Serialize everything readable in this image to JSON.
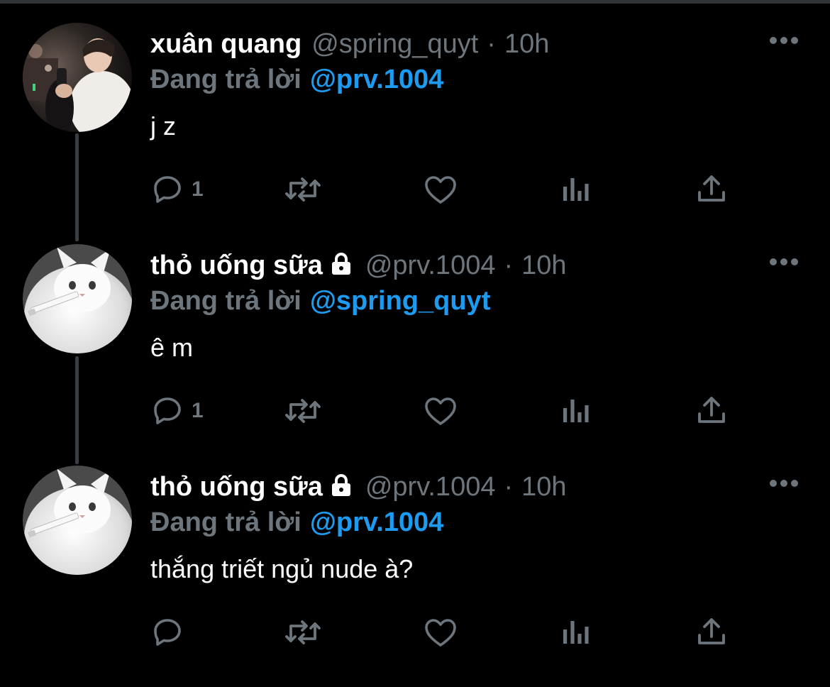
{
  "colors": {
    "background": "#000000",
    "text_primary": "#ffffff",
    "text_secondary": "#6e767d",
    "accent": "#1d9bf0",
    "thread_line": "#3a3d41"
  },
  "tweets": [
    {
      "name": "xuân quang",
      "locked": false,
      "handle": "@spring_quyt",
      "separator": "·",
      "time": "10h",
      "reply_prefix": "Đang trả lời",
      "reply_to": "@prv.1004",
      "text": "j z",
      "reply_count": "1",
      "avatar": "person-photo-avatar"
    },
    {
      "name": "thỏ uống sữa",
      "locked": true,
      "handle": "@prv.1004",
      "separator": "·",
      "time": "10h",
      "reply_prefix": "Đang trả lời",
      "reply_to": "@spring_quyt",
      "text": "ê m",
      "reply_count": "1",
      "avatar": "white-cat-avatar"
    },
    {
      "name": "thỏ uống sữa",
      "locked": true,
      "handle": "@prv.1004",
      "separator": "·",
      "time": "10h",
      "reply_prefix": "Đang trả lời",
      "reply_to": "@prv.1004",
      "text": "thắng triết ngủ nude à?",
      "reply_count": "",
      "avatar": "white-cat-avatar"
    }
  ],
  "icons": {
    "more": "more-horizontal-icon",
    "reply": "reply-bubble-icon",
    "retweet": "retweet-icon",
    "like": "heart-icon",
    "views": "analytics-bars-icon",
    "share": "share-upload-icon",
    "lock": "lock-icon"
  }
}
